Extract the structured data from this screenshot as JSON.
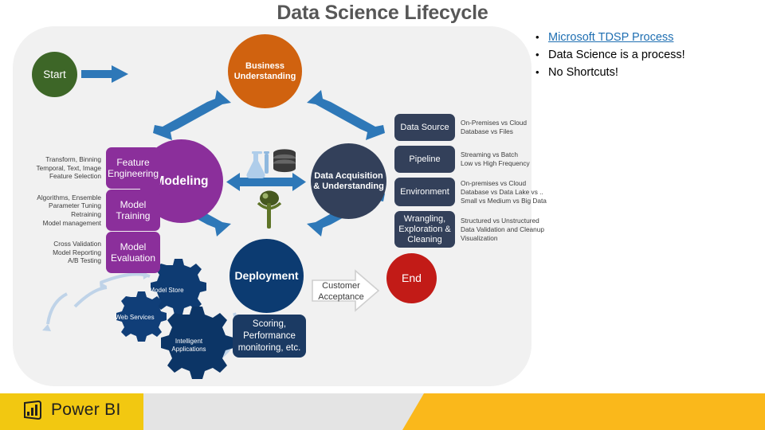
{
  "slide": {
    "title": "Data Science Lifecycle"
  },
  "bullets": [
    {
      "text": "Microsoft TDSP Process",
      "is_link": true,
      "color": "#1F6FB2"
    },
    {
      "text": "Data Science is a process!",
      "is_link": false
    },
    {
      "text": "No Shortcuts!",
      "is_link": false
    }
  ],
  "diagram": {
    "nodes": {
      "start": {
        "label": "Start",
        "color": "#3D6627"
      },
      "business_understanding": {
        "label": "Business Understanding",
        "color": "#D0620F"
      },
      "modeling": {
        "label": "Modeling",
        "color": "#8B2F9B"
      },
      "data_acquisition": {
        "label": "Data Acquisition & Understanding",
        "color": "#33405A"
      },
      "deployment": {
        "label": "Deployment",
        "color": "#0C3B71"
      },
      "end": {
        "label": "End",
        "color": "#C21B17"
      }
    },
    "modeling_items": [
      {
        "label": "Feature Engineering",
        "caption": "Transform, Binning\nTemporal, Text, Image\nFeature Selection"
      },
      {
        "label": "Model Training",
        "caption": "Algorithms, Ensemble\nParameter Tuning\nRetraining\nModel management"
      },
      {
        "label": "Model Evaluation",
        "caption": "Cross Validation\nModel Reporting\nA/B Testing"
      }
    ],
    "data_items": [
      {
        "label": "Data Source",
        "caption": "On-Premises vs Cloud\nDatabase vs Files"
      },
      {
        "label": "Pipeline",
        "caption": "Streaming vs Batch\nLow vs High Frequency"
      },
      {
        "label": "Environment",
        "caption": "On-premises vs Cloud\nDatabase vs Data Lake  vs ..\nSmall vs Medium vs Big Data"
      },
      {
        "label": "Wrangling, Exploration & Cleaning",
        "caption": "Structured vs Unstructured\nData Validation and Cleanup\nVisualization"
      }
    ],
    "deployment_items": {
      "scoring_box": "Scoring, Performance monitoring, etc.",
      "gears": [
        {
          "label": "Model Store"
        },
        {
          "label": "Web Services"
        },
        {
          "label": "Intelligent Applications"
        }
      ]
    },
    "customer_acceptance": "Customer Acceptance",
    "canvas_color": "#f1f1f1",
    "arrow_color": "#2E78B8"
  },
  "footer": {
    "brand": "Power BI",
    "yellow": "#F2C811",
    "gray": "#E4E4E4"
  }
}
